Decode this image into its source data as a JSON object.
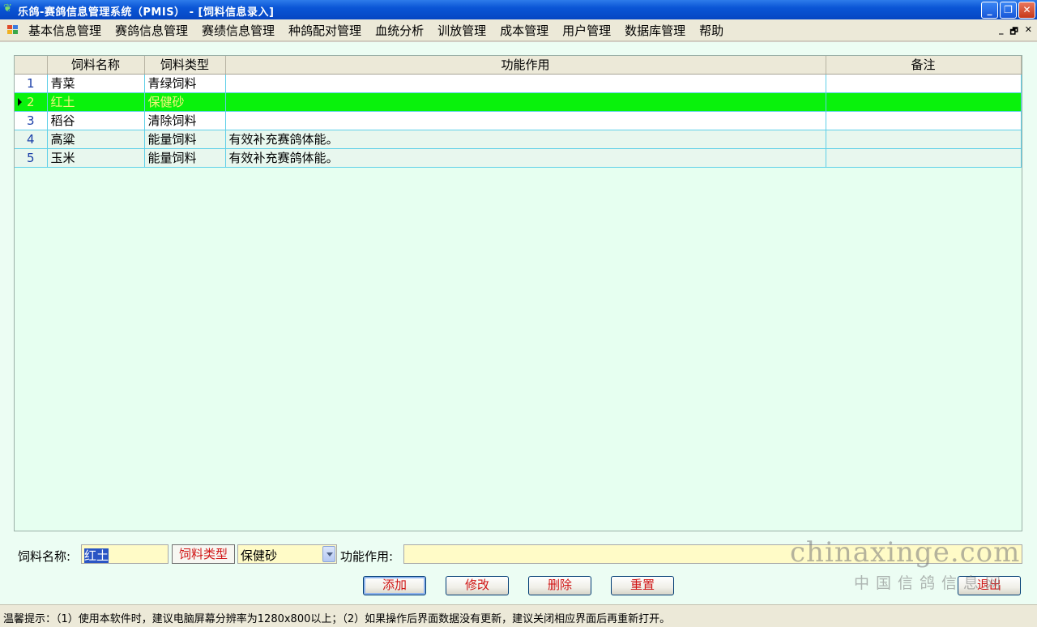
{
  "window": {
    "title": "乐鸽-赛鸽信息管理系统（PMIS） - [饲料信息录入]",
    "buttons": {
      "minimize": "_",
      "restore": "❐",
      "close": "✕"
    }
  },
  "menu": {
    "items": [
      "基本信息管理",
      "赛鸽信息管理",
      "赛绩信息管理",
      "种鸽配对管理",
      "血统分析",
      "训放管理",
      "成本管理",
      "用户管理",
      "数据库管理",
      "帮助"
    ],
    "mdi_buttons": {
      "minimize": "_",
      "restore": "🗗",
      "close": "✕"
    }
  },
  "grid": {
    "columns": [
      "",
      "饲料名称",
      "饲料类型",
      "功能作用",
      "备注"
    ],
    "rows": [
      {
        "no": "1",
        "name": "青菜",
        "type": "青绿饲料",
        "function": "",
        "remark": ""
      },
      {
        "no": "2",
        "name": "红土",
        "type": "保健砂",
        "function": "",
        "remark": ""
      },
      {
        "no": "3",
        "name": "稻谷",
        "type": "清除饲料",
        "function": "",
        "remark": ""
      },
      {
        "no": "4",
        "name": "高粱",
        "type": "能量饲料",
        "function": "有效补充赛鸽体能。",
        "remark": ""
      },
      {
        "no": "5",
        "name": "玉米",
        "type": "能量饲料",
        "function": "有效补充赛鸽体能。",
        "remark": ""
      }
    ],
    "selected_row": 2,
    "colors": {
      "selected_bg": "#09f20c",
      "selected_text": "#f5f57c",
      "border": "#5fd0e8"
    }
  },
  "form": {
    "name_label": "饲料名称:",
    "name_value": "红土",
    "type_button": "饲料类型",
    "type_value": "保健砂",
    "function_label": "功能作用:",
    "function_value": ""
  },
  "actions": {
    "add": "添加",
    "modify": "修改",
    "delete": "删除",
    "reset": "重置",
    "exit": "退出"
  },
  "watermark": {
    "brand": "chinaxinge.com",
    "cn": "中国信鸽信息网"
  },
  "status": "温馨提示：（1）使用本软件时，建议电脑屏幕分辨率为1280x800以上；（2）如果操作后界面数据没有更新，建议关闭相应界面后再重新打开。"
}
